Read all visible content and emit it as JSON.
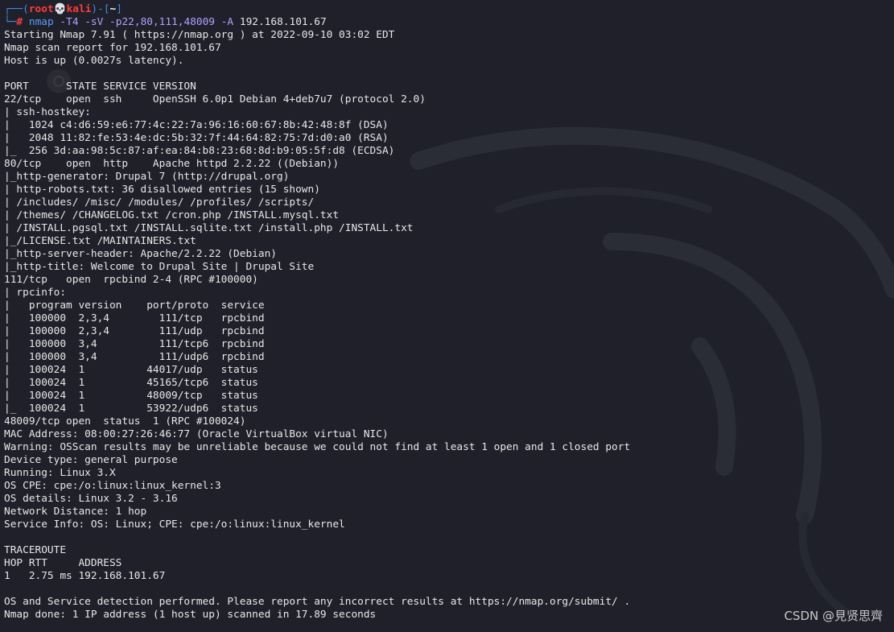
{
  "prompt": {
    "frame_top": "┌──(",
    "user": "root",
    "skull": "💀",
    "host": "kali",
    "dir_open": ")-[",
    "dir": "~",
    "dir_close": "]",
    "frame_bottom": "└─",
    "hash": "#",
    "command": "nmap",
    "options": "-T4 -sV -p22,80,111,48009 -A",
    "target": "192.168.101.67"
  },
  "output": [
    "Starting Nmap 7.91 ( https://nmap.org ) at 2022-09-10 03:02 EDT",
    "Nmap scan report for 192.168.101.67",
    "Host is up (0.0027s latency).",
    "",
    "PORT      STATE SERVICE VERSION",
    "22/tcp    open  ssh     OpenSSH 6.0p1 Debian 4+deb7u7 (protocol 2.0)",
    "| ssh-hostkey:",
    "|   1024 c4:d6:59:e6:77:4c:22:7a:96:16:60:67:8b:42:48:8f (DSA)",
    "|   2048 11:82:fe:53:4e:dc:5b:32:7f:44:64:82:75:7d:d0:a0 (RSA)",
    "|_  256 3d:aa:98:5c:87:af:ea:84:b8:23:68:8d:b9:05:5f:d8 (ECDSA)",
    "80/tcp    open  http    Apache httpd 2.2.22 ((Debian))",
    "|_http-generator: Drupal 7 (http://drupal.org)",
    "| http-robots.txt: 36 disallowed entries (15 shown)",
    "| /includes/ /misc/ /modules/ /profiles/ /scripts/",
    "| /themes/ /CHANGELOG.txt /cron.php /INSTALL.mysql.txt",
    "| /INSTALL.pgsql.txt /INSTALL.sqlite.txt /install.php /INSTALL.txt",
    "|_/LICENSE.txt /MAINTAINERS.txt",
    "|_http-server-header: Apache/2.2.22 (Debian)",
    "|_http-title: Welcome to Drupal Site | Drupal Site",
    "111/tcp   open  rpcbind 2-4 (RPC #100000)",
    "| rpcinfo:",
    "|   program version    port/proto  service",
    "|   100000  2,3,4        111/tcp   rpcbind",
    "|   100000  2,3,4        111/udp   rpcbind",
    "|   100000  3,4          111/tcp6  rpcbind",
    "|   100000  3,4          111/udp6  rpcbind",
    "|   100024  1          44017/udp   status",
    "|   100024  1          45165/tcp6  status",
    "|   100024  1          48009/tcp   status",
    "|_  100024  1          53922/udp6  status",
    "48009/tcp open  status  1 (RPC #100024)",
    "MAC Address: 08:00:27:26:46:77 (Oracle VirtualBox virtual NIC)",
    "Warning: OSScan results may be unreliable because we could not find at least 1 open and 1 closed port",
    "Device type: general purpose",
    "Running: Linux 3.X",
    "OS CPE: cpe:/o:linux:linux_kernel:3",
    "OS details: Linux 3.2 - 3.16",
    "Network Distance: 1 hop",
    "Service Info: OS: Linux; CPE: cpe:/o:linux:linux_kernel",
    "",
    "TRACEROUTE",
    "HOP RTT     ADDRESS",
    "1   2.75 ms 192.168.101.67",
    "",
    "OS and Service detection performed. Please report any incorrect results at https://nmap.org/submit/ .",
    "Nmap done: 1 IP address (1 host up) scanned in 17.89 seconds"
  ],
  "watermark": "CSDN @見贤思齊",
  "colors": {
    "background": "#1f2029",
    "prompt_frame": "#3b8eea",
    "prompt_user": "#ff3b3b",
    "command": "#5c9cff",
    "options": "#b4a0ff",
    "text": "#e8e8e8"
  },
  "icons": {
    "background_logo": "kali-dragon-icon",
    "prompt_skull": "skull-icon"
  }
}
